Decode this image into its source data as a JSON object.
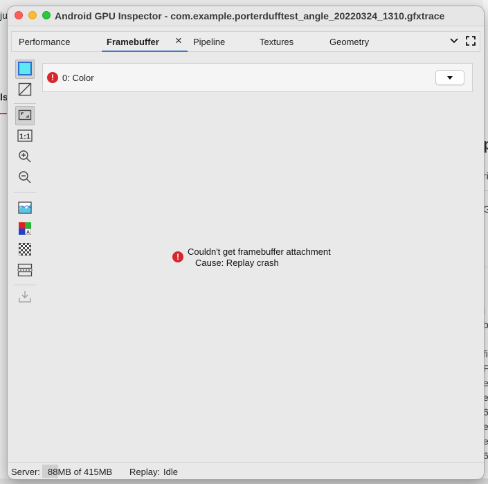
{
  "window": {
    "title": "Android GPU Inspector - com.example.porterdufftest_angle_20220324_1310.gfxtrace"
  },
  "background_fragments": {
    "left": [
      "ju",
      "ls"
    ],
    "right": [
      "p",
      "ri",
      "G",
      "i",
      "b",
      "fi",
      "F",
      "e",
      "e",
      "6",
      "e",
      "e",
      "6"
    ]
  },
  "tabs": [
    {
      "label": "Performance"
    },
    {
      "label": "Framebuffer",
      "active": true
    },
    {
      "label": "Pipeline"
    },
    {
      "label": "Textures"
    },
    {
      "label": "Geometry"
    }
  ],
  "toolbar": {
    "tools": [
      {
        "icon": "color-attachment-icon",
        "selected": true
      },
      {
        "icon": "wireframe-icon"
      },
      {
        "icon": "fit-to-window-icon",
        "selected": true
      },
      {
        "icon": "original-size-icon",
        "label": "1:1"
      },
      {
        "icon": "zoom-in-icon"
      },
      {
        "icon": "zoom-out-icon"
      },
      {
        "icon": "histogram-icon"
      },
      {
        "icon": "color-channels-icon",
        "label": "A"
      },
      {
        "icon": "checkerboard-icon"
      },
      {
        "icon": "flip-vertical-icon"
      },
      {
        "icon": "download-icon"
      }
    ]
  },
  "attachment": {
    "label": "0: Color"
  },
  "error": {
    "line1": "Couldn't get framebuffer attachment",
    "line2": "Cause: Replay crash"
  },
  "status": {
    "server_label": "Server:",
    "server_value": "88MB of 415MB",
    "replay_label": "Replay:",
    "replay_value": "Idle"
  },
  "colors": {
    "accent": "#3d77c9",
    "error": "#d7262c",
    "traffic_close": "#ff5f57",
    "traffic_min": "#febc2e",
    "traffic_max": "#28c840"
  }
}
